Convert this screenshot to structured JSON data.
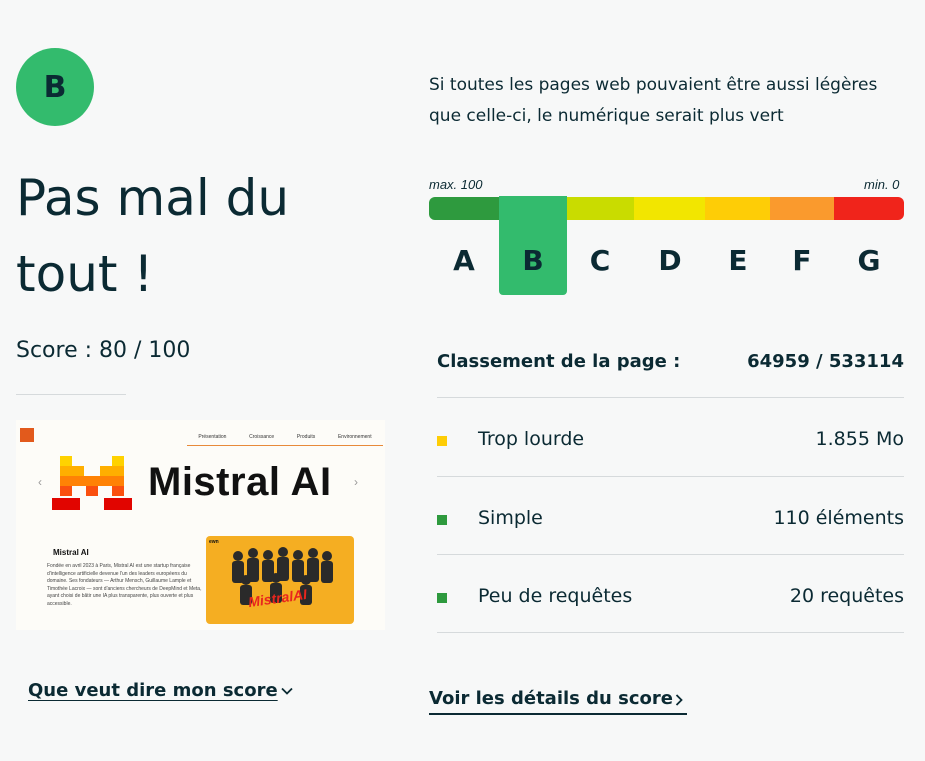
{
  "grade": "B",
  "verdict": "Pas mal du tout !",
  "score": "Score : 80 / 100",
  "thumbnail": {
    "nav_items": [
      "Présentation",
      "Croissance",
      "Produits",
      "Environnement"
    ],
    "hero_title": "Mistral AI",
    "card_title": "Mistral AI",
    "card_text": "Fondée en avril 2023 à Paris, Mistral AI est une startup française d'intelligence artificielle devenue l'un des leaders européens du domaine. Ses fondateurs — Arthur Mensch, Guillaume Lample et Timothée Lacroix — sont d'anciens chercheurs de DeepMind et Meta, ayant choisi de bâtir une IA plus transparente, plus ouverte et plus accessible.",
    "photo_label": "ewn",
    "photo_brand": "MistralAI"
  },
  "left_link": "Que veut dire mon score",
  "tagline": "Si toutes les pages web pouvaient être aussi légères que celle-ci, le numérique serait plus vert",
  "scale": {
    "max_label": "max. 100",
    "min_label": "min. 0",
    "grades": [
      "A",
      "B",
      "C",
      "D",
      "E",
      "F",
      "G"
    ],
    "colors": [
      "#2e9a3e",
      "#c9dc00",
      "#f2e600",
      "#fecd06",
      "#fa9a2d",
      "#f0241b"
    ],
    "active": "B",
    "active_color": "#33bb6d"
  },
  "ranking": {
    "label": "Classement de la page :",
    "value": "64959 / 533114"
  },
  "metrics": [
    {
      "label": "Trop lourde",
      "value": "1.855 Mo",
      "color": "#fecd06"
    },
    {
      "label": "Simple",
      "value": "110 éléments",
      "color": "#2e9a3e"
    },
    {
      "label": "Peu de requêtes",
      "value": "20 requêtes",
      "color": "#2e9a3e"
    }
  ],
  "right_link": "Voir les détails du score"
}
